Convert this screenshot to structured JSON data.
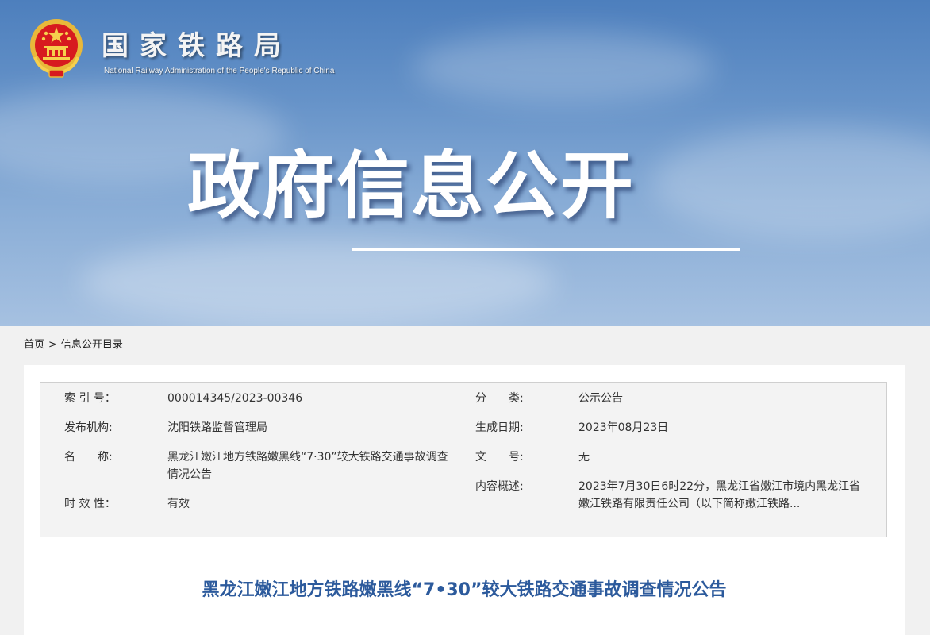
{
  "header": {
    "logo_cn": "国家铁路局",
    "logo_en": "National Railway Administration of the People's Republic of China",
    "emblem_icon": "national-emblem-icon",
    "banner_title": "政府信息公开"
  },
  "breadcrumb": {
    "home": "首页",
    "separator": ">",
    "current": "信息公开目录"
  },
  "meta": {
    "index_label": "索 引 号：",
    "index_value": "000014345/2023-00346",
    "category_label": "分　　类:",
    "category_value": "公示公告",
    "publisher_label": "发布机构:",
    "publisher_value": "沈阳铁路监督管理局",
    "date_label": "生成日期:",
    "date_value": "2023年08月23日",
    "name_label": "名　　称:",
    "name_value": "黑龙江嫩江地方铁路嫩黑线“7·30”较大铁路交通事故调查情况公告",
    "docno_label": "文　　号:",
    "docno_value": "无",
    "summary_label": "内容概述:",
    "summary_value": "2023年7月30日6时22分，黑龙江省嫩江市境内黑龙江省嫩江铁路有限责任公司（以下简称嫩江铁路...",
    "validity_label": "时 效 性：",
    "validity_value": "有效"
  },
  "article": {
    "title": "黑龙江嫩江地方铁路嫩黑线“7•30”较大铁路交通事故调查情况公告"
  },
  "colors": {
    "title_blue": "#2c5a9c",
    "emblem_red": "#d71a1f",
    "emblem_gold": "#e8b83a"
  }
}
